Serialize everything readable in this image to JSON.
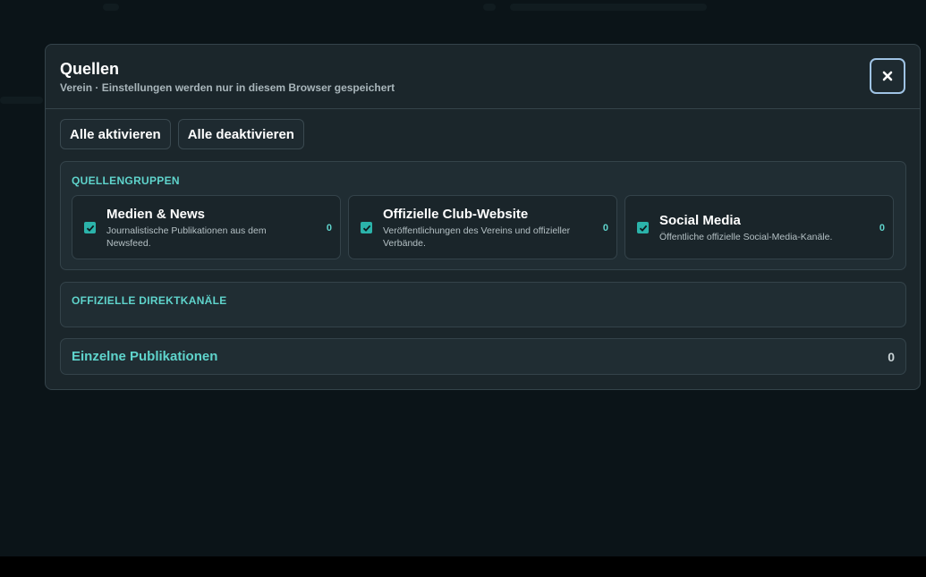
{
  "modal": {
    "title": "Quellen",
    "subtitle": "Verein · Einstellungen werden nur in diesem Browser gespeichert",
    "close_icon": "close-icon"
  },
  "toolbar": {
    "enable_all_label": "Alle aktivieren",
    "disable_all_label": "Alle deaktivieren"
  },
  "groups_section": {
    "heading": "QUELLENGRUPPEN",
    "cards": [
      {
        "title": "Medien & News",
        "description": "Journalistische Publikationen aus dem Newsfeed.",
        "count": "0",
        "checked": true
      },
      {
        "title": "Offizielle Club-Website",
        "description": "Veröffentlichungen des Vereins und offizieller Verbände.",
        "count": "0",
        "checked": true
      },
      {
        "title": "Social Media",
        "description": "Öffentliche offizielle Social-Media-Kanäle.",
        "count": "0",
        "checked": true
      }
    ]
  },
  "direct_section": {
    "heading": "OFFIZIELLE DIREKTKANÄLE"
  },
  "publications_section": {
    "label": "Einzelne Publikationen",
    "count": "0"
  },
  "colors": {
    "accent": "#5fd4cc",
    "checkbox": "#2bb3aa",
    "modal_bg": "#1b262b",
    "backdrop": "#0b1418"
  }
}
